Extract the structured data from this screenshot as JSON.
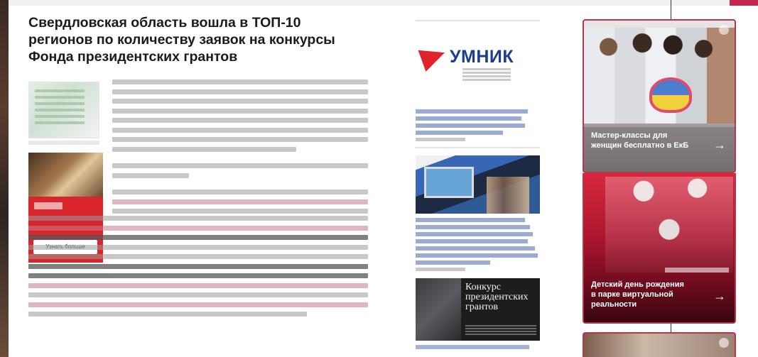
{
  "colors": {
    "brand_red": "#d9262c",
    "link_blue": "#5a73b7",
    "ad_border": "#b23a48",
    "umnik_blue": "#1b3f8f"
  },
  "article": {
    "title": "Свердловская область вошла в ТОП-10 регионов по количеству заявок на конкурсы Фонда президентских грантов",
    "sidebar_ad_button": "Узнать больше"
  },
  "middle": {
    "umnik_logo": "УМНИК",
    "grant_card_text": "Конкурс президентских грантов"
  },
  "right": {
    "ad1": {
      "text": "Мастер-классы для женщин бесплатно в ЕкБ",
      "arrow": "→"
    },
    "ad2": {
      "text": "Детский день рождения в парке виртуальной реальности",
      "arrow": "→"
    }
  }
}
